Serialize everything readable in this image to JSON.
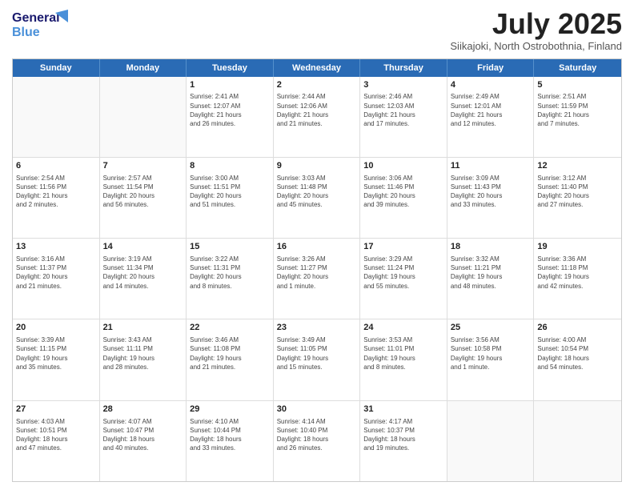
{
  "header": {
    "logo_general": "General",
    "logo_blue": "Blue",
    "title": "July 2025",
    "subtitle": "Siikajoki, North Ostrobothnia, Finland"
  },
  "days_of_week": [
    "Sunday",
    "Monday",
    "Tuesday",
    "Wednesday",
    "Thursday",
    "Friday",
    "Saturday"
  ],
  "weeks": [
    [
      {
        "day": "",
        "info": ""
      },
      {
        "day": "",
        "info": ""
      },
      {
        "day": "1",
        "info": "Sunrise: 2:41 AM\nSunset: 12:07 AM\nDaylight: 21 hours\nand 26 minutes."
      },
      {
        "day": "2",
        "info": "Sunrise: 2:44 AM\nSunset: 12:06 AM\nDaylight: 21 hours\nand 21 minutes."
      },
      {
        "day": "3",
        "info": "Sunrise: 2:46 AM\nSunset: 12:03 AM\nDaylight: 21 hours\nand 17 minutes."
      },
      {
        "day": "4",
        "info": "Sunrise: 2:49 AM\nSunset: 12:01 AM\nDaylight: 21 hours\nand 12 minutes."
      },
      {
        "day": "5",
        "info": "Sunrise: 2:51 AM\nSunset: 11:59 PM\nDaylight: 21 hours\nand 7 minutes."
      }
    ],
    [
      {
        "day": "6",
        "info": "Sunrise: 2:54 AM\nSunset: 11:56 PM\nDaylight: 21 hours\nand 2 minutes."
      },
      {
        "day": "7",
        "info": "Sunrise: 2:57 AM\nSunset: 11:54 PM\nDaylight: 20 hours\nand 56 minutes."
      },
      {
        "day": "8",
        "info": "Sunrise: 3:00 AM\nSunset: 11:51 PM\nDaylight: 20 hours\nand 51 minutes."
      },
      {
        "day": "9",
        "info": "Sunrise: 3:03 AM\nSunset: 11:48 PM\nDaylight: 20 hours\nand 45 minutes."
      },
      {
        "day": "10",
        "info": "Sunrise: 3:06 AM\nSunset: 11:46 PM\nDaylight: 20 hours\nand 39 minutes."
      },
      {
        "day": "11",
        "info": "Sunrise: 3:09 AM\nSunset: 11:43 PM\nDaylight: 20 hours\nand 33 minutes."
      },
      {
        "day": "12",
        "info": "Sunrise: 3:12 AM\nSunset: 11:40 PM\nDaylight: 20 hours\nand 27 minutes."
      }
    ],
    [
      {
        "day": "13",
        "info": "Sunrise: 3:16 AM\nSunset: 11:37 PM\nDaylight: 20 hours\nand 21 minutes."
      },
      {
        "day": "14",
        "info": "Sunrise: 3:19 AM\nSunset: 11:34 PM\nDaylight: 20 hours\nand 14 minutes."
      },
      {
        "day": "15",
        "info": "Sunrise: 3:22 AM\nSunset: 11:31 PM\nDaylight: 20 hours\nand 8 minutes."
      },
      {
        "day": "16",
        "info": "Sunrise: 3:26 AM\nSunset: 11:27 PM\nDaylight: 20 hours\nand 1 minute."
      },
      {
        "day": "17",
        "info": "Sunrise: 3:29 AM\nSunset: 11:24 PM\nDaylight: 19 hours\nand 55 minutes."
      },
      {
        "day": "18",
        "info": "Sunrise: 3:32 AM\nSunset: 11:21 PM\nDaylight: 19 hours\nand 48 minutes."
      },
      {
        "day": "19",
        "info": "Sunrise: 3:36 AM\nSunset: 11:18 PM\nDaylight: 19 hours\nand 42 minutes."
      }
    ],
    [
      {
        "day": "20",
        "info": "Sunrise: 3:39 AM\nSunset: 11:15 PM\nDaylight: 19 hours\nand 35 minutes."
      },
      {
        "day": "21",
        "info": "Sunrise: 3:43 AM\nSunset: 11:11 PM\nDaylight: 19 hours\nand 28 minutes."
      },
      {
        "day": "22",
        "info": "Sunrise: 3:46 AM\nSunset: 11:08 PM\nDaylight: 19 hours\nand 21 minutes."
      },
      {
        "day": "23",
        "info": "Sunrise: 3:49 AM\nSunset: 11:05 PM\nDaylight: 19 hours\nand 15 minutes."
      },
      {
        "day": "24",
        "info": "Sunrise: 3:53 AM\nSunset: 11:01 PM\nDaylight: 19 hours\nand 8 minutes."
      },
      {
        "day": "25",
        "info": "Sunrise: 3:56 AM\nSunset: 10:58 PM\nDaylight: 19 hours\nand 1 minute."
      },
      {
        "day": "26",
        "info": "Sunrise: 4:00 AM\nSunset: 10:54 PM\nDaylight: 18 hours\nand 54 minutes."
      }
    ],
    [
      {
        "day": "27",
        "info": "Sunrise: 4:03 AM\nSunset: 10:51 PM\nDaylight: 18 hours\nand 47 minutes."
      },
      {
        "day": "28",
        "info": "Sunrise: 4:07 AM\nSunset: 10:47 PM\nDaylight: 18 hours\nand 40 minutes."
      },
      {
        "day": "29",
        "info": "Sunrise: 4:10 AM\nSunset: 10:44 PM\nDaylight: 18 hours\nand 33 minutes."
      },
      {
        "day": "30",
        "info": "Sunrise: 4:14 AM\nSunset: 10:40 PM\nDaylight: 18 hours\nand 26 minutes."
      },
      {
        "day": "31",
        "info": "Sunrise: 4:17 AM\nSunset: 10:37 PM\nDaylight: 18 hours\nand 19 minutes."
      },
      {
        "day": "",
        "info": ""
      },
      {
        "day": "",
        "info": ""
      }
    ]
  ]
}
